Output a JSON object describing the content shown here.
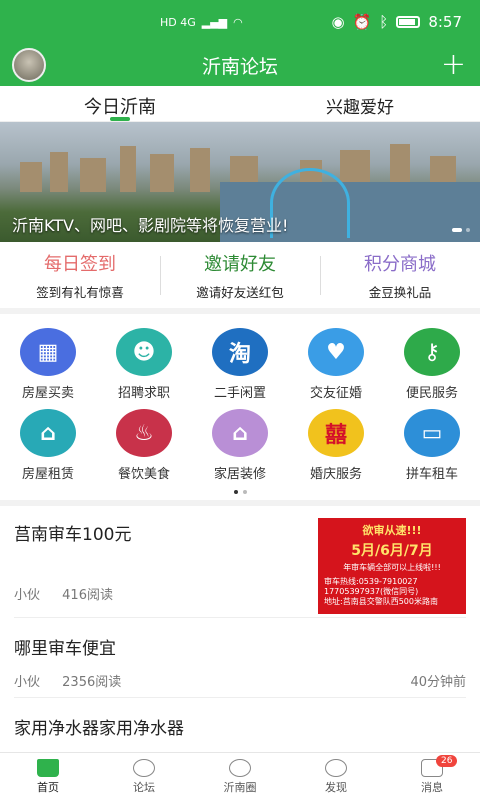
{
  "status_bar": {
    "network": "HD 4G",
    "time": "8:57"
  },
  "header": {
    "title": "沂南论坛",
    "add_icon": "plus-icon"
  },
  "tabs": [
    {
      "label": "今日沂南",
      "active": true
    },
    {
      "label": "兴趣爱好",
      "active": false
    }
  ],
  "banner": {
    "caption": "沂南KTV、网吧、影剧院等将恢复营业!"
  },
  "quick_actions": [
    {
      "title": "每日签到",
      "subtitle": "签到有礼有惊喜",
      "color": "#e46b6b"
    },
    {
      "title": "邀请好友",
      "subtitle": "邀请好友送红包",
      "color": "#2d8a34"
    },
    {
      "title": "积分商城",
      "subtitle": "金豆换礼品",
      "color": "#8a6cc8"
    }
  ],
  "categories": [
    {
      "label": "房屋买卖",
      "icon": "building-icon",
      "color": "#4a6ee0",
      "glyph": "▦"
    },
    {
      "label": "招聘求职",
      "icon": "person-search-icon",
      "color": "#2cb3a6",
      "glyph": "☻"
    },
    {
      "label": "二手闲置",
      "icon": "taobao-icon",
      "color": "#1f6fc1",
      "glyph": "淘"
    },
    {
      "label": "交友征婚",
      "icon": "couple-icon",
      "color": "#3a9de6",
      "glyph": "♥"
    },
    {
      "label": "便民服务",
      "icon": "key-icon",
      "color": "#2eaa4a",
      "glyph": "⚷"
    },
    {
      "label": "房屋租赁",
      "icon": "house-icon",
      "color": "#28a9b6",
      "glyph": "⌂"
    },
    {
      "label": "餐饮美食",
      "icon": "dining-icon",
      "color": "#c8324a",
      "glyph": "♨"
    },
    {
      "label": "家居装修",
      "icon": "home-decor-icon",
      "color": "#b98fd6",
      "glyph": "⌂"
    },
    {
      "label": "婚庆服务",
      "icon": "wedding-icon",
      "color": "#f1c21d",
      "glyph": "囍"
    },
    {
      "label": "拼车租车",
      "icon": "car-icon",
      "color": "#2d8fd8",
      "glyph": "🚗"
    }
  ],
  "posts": [
    {
      "title": "莒南审车100元",
      "author": "小伙",
      "reads": "416阅读",
      "thumb": {
        "line1": "欲审从速!!!",
        "line2": "5月/6月/7月",
        "line3": "年审车辆全部可以上线啦!!!",
        "line4": "审车热线:0539-7910027",
        "line5": "17705397937(微信同号)",
        "line6": "地址:莒南县交警队西500米路南"
      }
    },
    {
      "title": "哪里审车便宜",
      "author": "小伙",
      "reads": "2356阅读",
      "time": "40分钟前"
    },
    {
      "title": "家用净水器家用净水器"
    }
  ],
  "bottom_nav": [
    {
      "label": "首页",
      "icon": "home-icon",
      "active": true
    },
    {
      "label": "论坛",
      "icon": "chat-icon"
    },
    {
      "label": "沂南圈",
      "icon": "circle-icon"
    },
    {
      "label": "发现",
      "icon": "compass-icon"
    },
    {
      "label": "消息",
      "icon": "mail-icon",
      "badge": "26"
    }
  ]
}
